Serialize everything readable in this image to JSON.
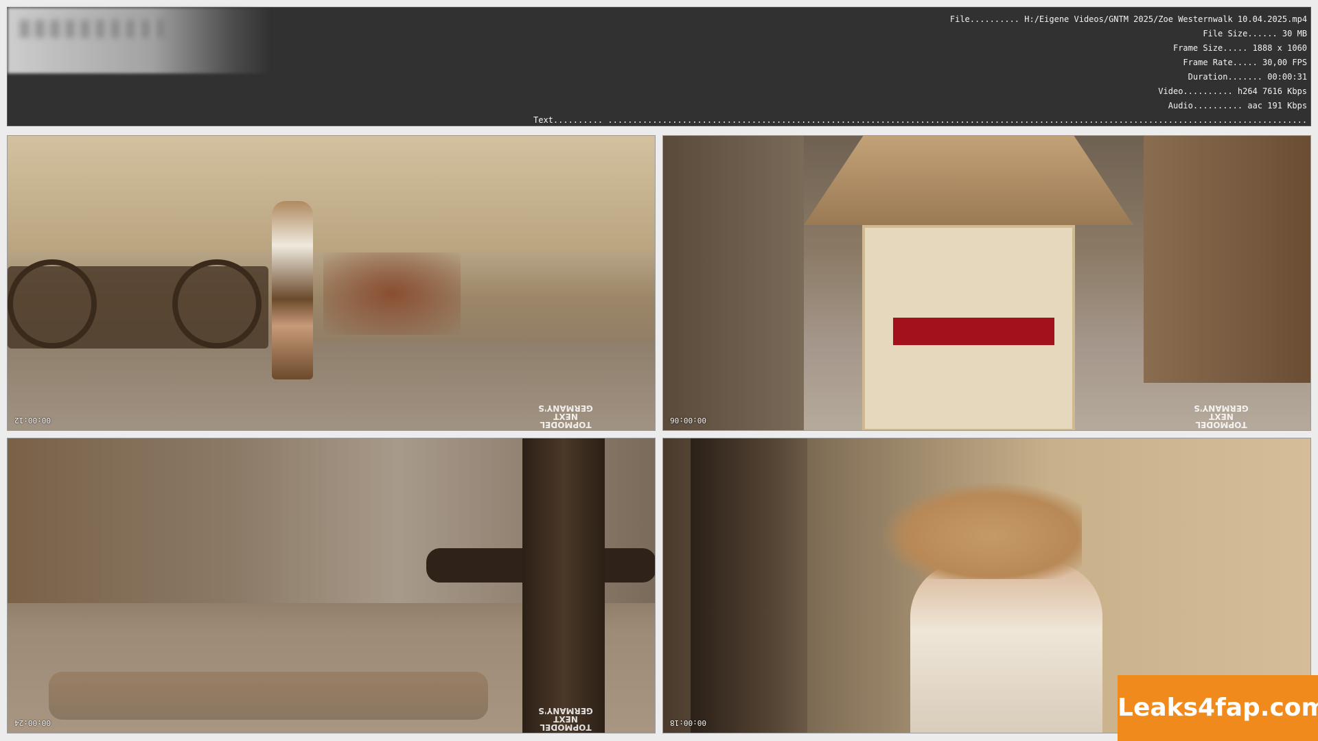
{
  "meta": {
    "file": "File.......... H:/Eigene Videos/GNTM 2025/Zoe Westernwalk 10.04.2025.mp4",
    "file_size": "File Size...... 30 MB",
    "frame_size": "Frame Size..... 1888 x 1060",
    "frame_rate": "Frame Rate..... 30,00 FPS",
    "duration": "Duration....... 00:00:31",
    "video": "Video.......... h264 7616 Kbps",
    "audio": "Audio.......... aac 191 Kbps",
    "text": "Text.......... ............................................................................................................................................."
  },
  "thumbnails": [
    {
      "timestamp": "00:00:12",
      "logo": [
        "GERMANY'S",
        "NEXT",
        "TOPMODEL"
      ]
    },
    {
      "timestamp": "00:00:06",
      "logo": [
        "GERMANY'S",
        "NEXT",
        "TOPMODEL"
      ]
    },
    {
      "timestamp": "00:00:24",
      "logo": [
        "GERMANY'S",
        "NEXT",
        "TOPMODEL"
      ]
    },
    {
      "timestamp": "00:00:18",
      "logo": []
    }
  ],
  "watermark": "Leaks4fap.com",
  "colors": {
    "panel_bg": "#313131",
    "page_bg": "#ececec",
    "watermark_bg": "#f08a1d"
  }
}
